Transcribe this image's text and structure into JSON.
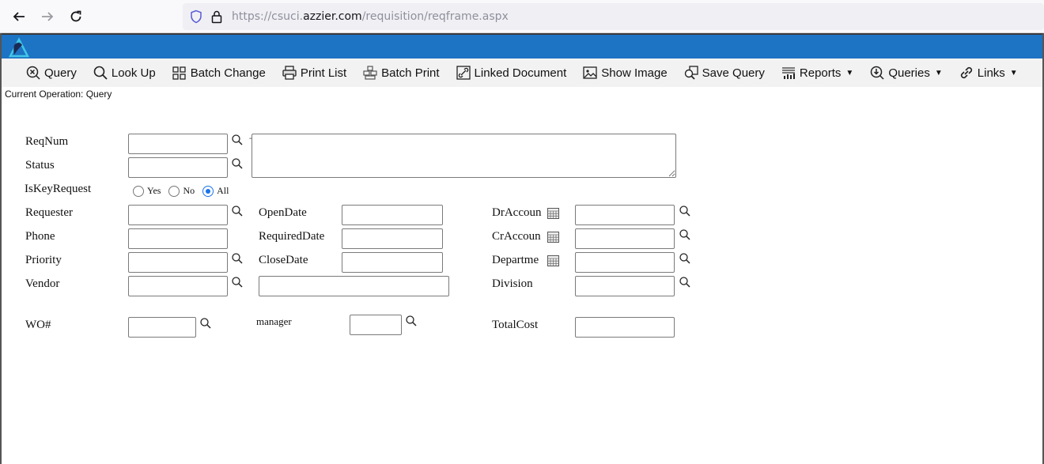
{
  "browser": {
    "url_prefix": "https://csuci.",
    "url_host": "azzier.com",
    "url_path": "/requisition/reqframe.aspx"
  },
  "toolbar": {
    "items": [
      {
        "label": "Query",
        "icon": "query-icon"
      },
      {
        "label": "Look Up",
        "icon": "search-icon"
      },
      {
        "label": "Batch Change",
        "icon": "grid-icon"
      },
      {
        "label": "Print List",
        "icon": "printer-icon"
      },
      {
        "label": "Batch Print",
        "icon": "stack-icon"
      },
      {
        "label": "Linked Document",
        "icon": "link-document-icon"
      },
      {
        "label": "Show Image",
        "icon": "image-icon"
      },
      {
        "label": "Save Query",
        "icon": "save-query-icon"
      },
      {
        "label": "Reports",
        "icon": "report-icon"
      },
      {
        "label": "Queries",
        "icon": "queries-icon"
      },
      {
        "label": "Links",
        "icon": "link-icon"
      }
    ]
  },
  "status": {
    "current_operation": "Current Operation: Query"
  },
  "form": {
    "reqnum_label": "ReqNum",
    "status_label": "Status",
    "iskeyrequest_label": "IsKeyRequest",
    "radio_yes": "Yes",
    "radio_no": "No",
    "radio_all": "All",
    "radio_selected": "All",
    "requester_label": "Requester",
    "phone_label": "Phone",
    "priority_label": "Priority",
    "vendor_label": "Vendor",
    "opendate_label": "OpenDate",
    "requireddate_label": "RequiredDate",
    "closedate_label": "CloseDate",
    "draccount_label": "DrAccoun",
    "craccount_label": "CrAccoun",
    "department_label": "Departme",
    "division_label": "Division",
    "wo_label": "WO#",
    "manager_label": "manager",
    "totalcost_label": "TotalCost"
  },
  "colors": {
    "header_blue": "#1d73c4",
    "toolbar_bg": "#f2f2f2",
    "radio_accent": "#1a73e8"
  }
}
